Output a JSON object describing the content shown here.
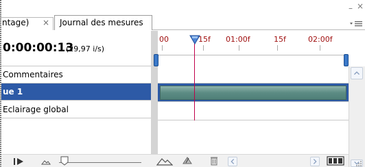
{
  "tabs": [
    {
      "label": "ntage)",
      "active": false
    },
    {
      "label": "Journal des mesures",
      "active": true
    }
  ],
  "header": {
    "timecode": "0:00:00:13",
    "framerate": "(29,97 i/s)"
  },
  "ruler": {
    "labels": [
      "00",
      "15f",
      "01:00f",
      "15f",
      "02:00f"
    ],
    "playhead_frame": 13
  },
  "tracks": [
    {
      "label": "Commentaires",
      "selected": false
    },
    {
      "label": "ue 1",
      "selected": true
    },
    {
      "label": "Eclairage global",
      "selected": false
    }
  ],
  "colors": {
    "selected_row": "#2d5aa6",
    "playhead": "#c0004a",
    "ruler_text": "#a01010",
    "layer_bar": "#5c8c84"
  },
  "icons": {
    "tab_close": "close-icon",
    "play": "play-icon",
    "zoom_out": "zoom-out-mountain-icon",
    "zoom_in": "zoom-in-mountain-icon",
    "camera": "camera-icon",
    "trash": "trash-icon",
    "filmstrip": "filmstrip-icon",
    "panel_menu": "panel-menu-icon"
  },
  "glyphs": {
    "tab_close": "×",
    "minimize": "–",
    "close": "×"
  }
}
